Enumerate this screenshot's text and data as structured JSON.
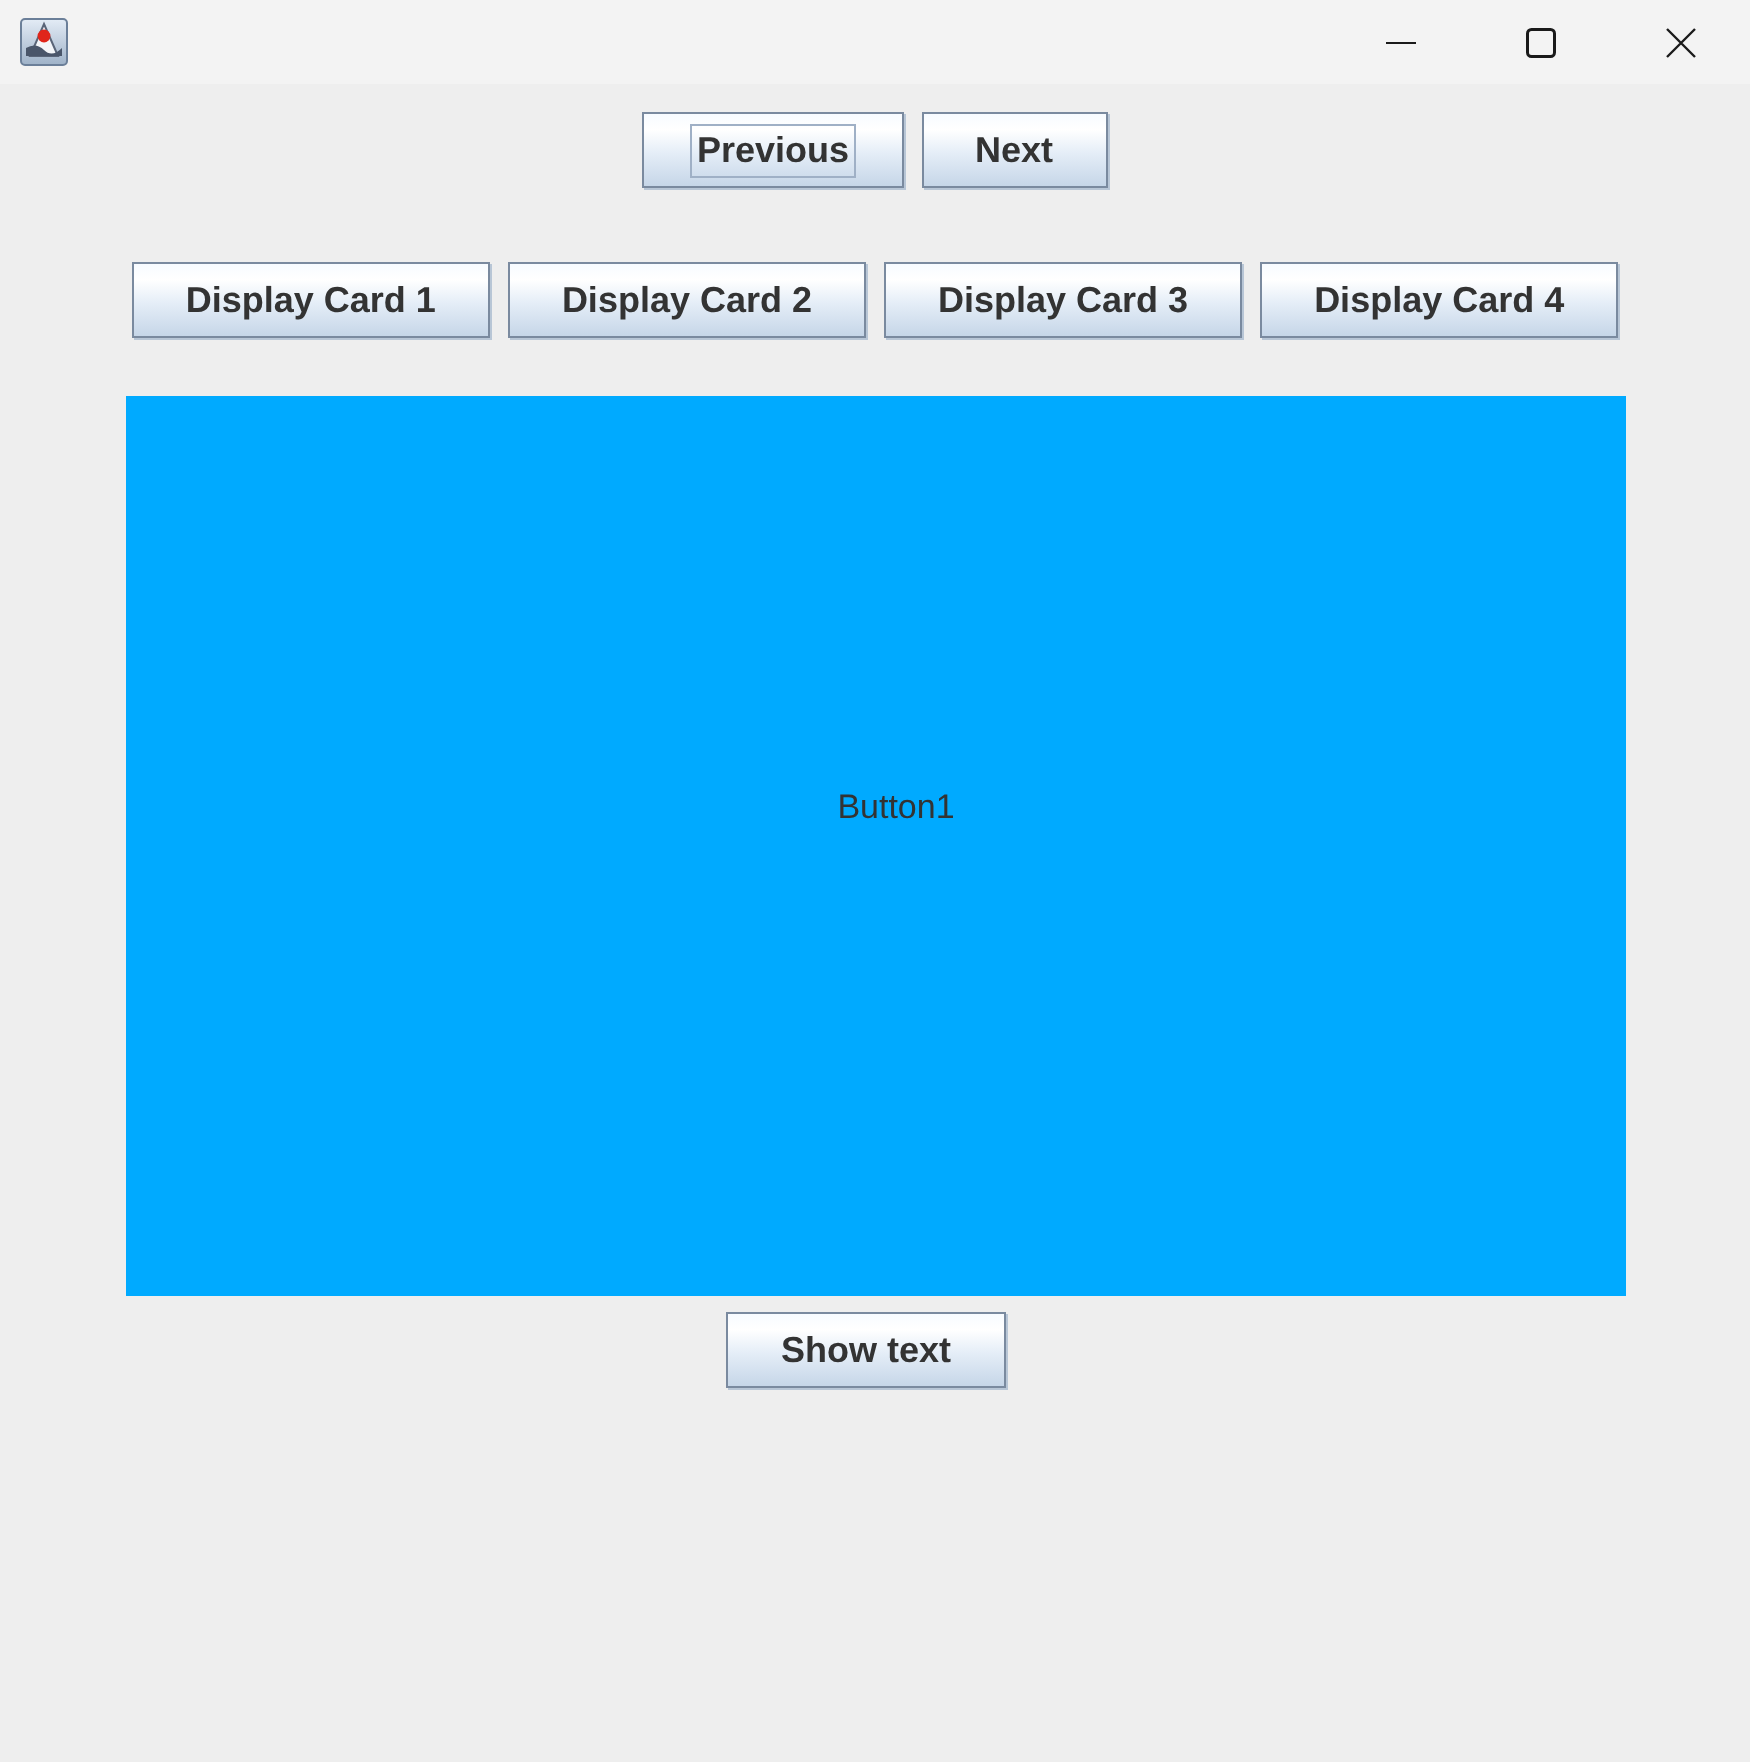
{
  "navigation_buttons": [
    {
      "label": "Previous",
      "focused": true
    },
    {
      "label": "Next",
      "focused": false
    }
  ],
  "card_buttons": [
    {
      "label": "Display Card 1"
    },
    {
      "label": "Display Card 2"
    },
    {
      "label": "Display Card 3"
    },
    {
      "label": "Display Card 4"
    }
  ],
  "card": {
    "label": "Button1"
  },
  "action_button": {
    "label": "Show text"
  }
}
